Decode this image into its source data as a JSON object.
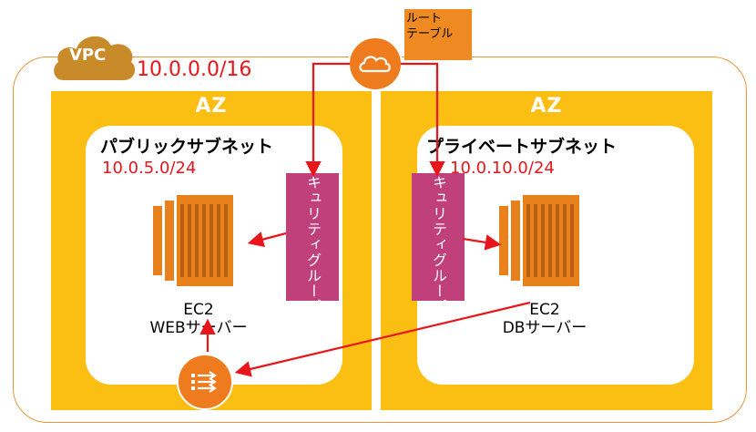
{
  "vpc": {
    "badge": "VPC",
    "cidr": "10.0.0.0/16"
  },
  "route_table": {
    "label_line1": "ルート",
    "label_line2": "テーブル",
    "icon": "cloud-icon"
  },
  "az_left": {
    "title": "AZ",
    "subnet_title": "パブリックサブネット",
    "subnet_cidr": "10.0.5.0/24",
    "security_group": "セキュリティグループ",
    "ec2_line1": "EC2",
    "ec2_line2": "WEBサーバー"
  },
  "az_right": {
    "title": "AZ",
    "subnet_title": "プライベートサブネット",
    "subnet_cidr": "10.0.10.0/24",
    "security_group": "セキュリティグループ",
    "ec2_line1": "EC2",
    "ec2_line2": "DBサーバー"
  },
  "gateway": {
    "icon": "gateway-icon"
  },
  "colors": {
    "vpc_border": "#e8963c",
    "az_fill": "#fbbe13",
    "security_group": "#c0407b",
    "ec2_orange": "#e8811c",
    "arrow_red": "#e8161b",
    "route_orange": "#ee7c1f"
  }
}
